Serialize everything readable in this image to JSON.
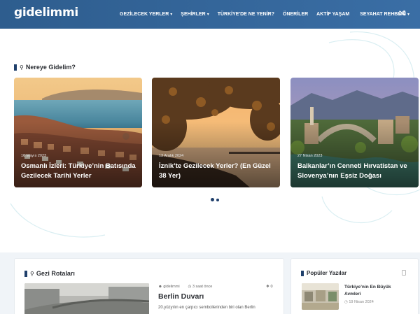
{
  "header": {
    "logo": "gidelimmi",
    "nav": [
      {
        "label": "GEZİLECEK YERLER",
        "dropdown": true
      },
      {
        "label": "ŞEHİRLER",
        "dropdown": true
      },
      {
        "label": "TÜRKİYE'DE NE YENİR?",
        "dropdown": false
      },
      {
        "label": "ÖNERİLER",
        "dropdown": false
      },
      {
        "label": "AKTİF YAŞAM",
        "dropdown": false
      },
      {
        "label": "SEYAHAT REHBERİ",
        "dropdown": true
      }
    ],
    "shuffle_icon": "shuffle-icon"
  },
  "hero": {
    "section_title": "Nereye Gidelim?",
    "cards": [
      {
        "date": "16 Mayıs 2023",
        "title": "Osmanlı İzleri: Türkiye’nin Batısında Gezilecek Tarihi Yerler"
      },
      {
        "date": "13 Aralık 2024",
        "title": "İznik’te Gezilecek Yerler? (En Güzel 38 Yer)"
      },
      {
        "date": "27 Nisan 2023",
        "title": "Balkanlar’ın Cenneti Hırvatistan ve Slovenya’nın Eşsiz Doğası"
      }
    ],
    "carousel_pages": 2,
    "carousel_active": 1
  },
  "routes": {
    "section_title": "Gezi Rotaları",
    "post": {
      "author": "gidelimmi",
      "time": "3 saat önce",
      "likes": "0",
      "title": "Berlin Duvarı",
      "excerpt": "20.yüzyılın en çarpıcı sembollerinden biri olan Berlin"
    }
  },
  "popular": {
    "section_title": "Popüler Yazılar",
    "item": {
      "title": "Türkiye’nin En Büyük Avmleri",
      "date": "19 Nisan 2024"
    }
  },
  "colors": {
    "header_start": "#2e5d8e",
    "header_end": "#3a6ea5",
    "accent": "#1f3f6b"
  }
}
